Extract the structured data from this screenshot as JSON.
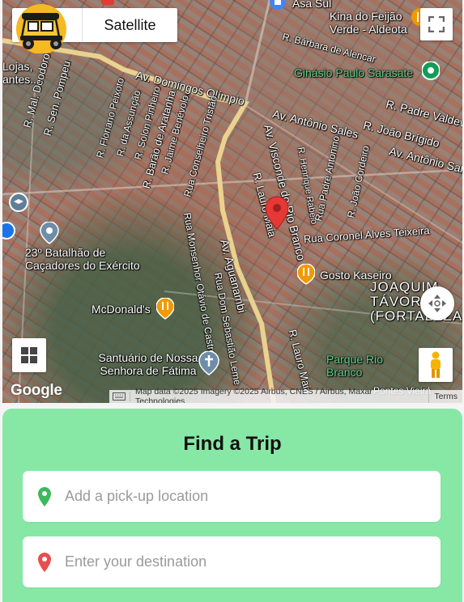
{
  "map": {
    "map_type": {
      "satellite_label": "Satellite"
    },
    "labels": {
      "streets": [
        "Av. Domingos Olímpio",
        "R. Sen. Pompeu",
        "R. Mal. Deodoro",
        "R. Floriano Peixoto",
        "R. da Assunção",
        "R. Solon Pinheiro",
        "R. Barão de Aratanha",
        "R. Jaime Benévolo",
        "Rua Conselheiro Tristão",
        "Av. Antônio Sales",
        "R. João Brígido",
        "Av. Antônio Sal",
        "R. Padre Valdevino",
        "R. Bárbara de Alencar",
        "Av. Visconde do Rio Branco",
        "R. Lauro Maia",
        "R. Henrique Rabelo",
        "Rua Padre Antonino",
        "R. João Cordeiro",
        "Rua Coronel Alves Teixeira",
        "Av. Aguanambi",
        "Rua Monsenhor Otávio de Castro",
        "Rua Dom Sebastião Leme",
        "R. Lauro Maia"
      ],
      "places": [
        "Asa Sul",
        "Kina do Feijão Verde - Aldeota",
        "Ginásio Paulo Sarasate",
        "23º Batalhão de Caçadores do Exército",
        "Gosto Kaseiro",
        "McDonald's",
        "Santuário de Nossa Senhora de Fátima",
        "JOAQUIM TÁVORA (FORTALEZA)",
        "Parque Rio Branco",
        "Lojas, antes...",
        "Pontes Vieira"
      ]
    },
    "google_logo": "Google",
    "attribution": "Map data ©2025 Imagery ©2025 Airbus, CNES / Airbus, Maxar Technologies",
    "terms": "Terms"
  },
  "trip": {
    "title": "Find a Trip",
    "pickup_placeholder": "Add a pick-up location",
    "destination_placeholder": "Enter your destination"
  },
  "colors": {
    "card_bg": "#87e8a5",
    "pickup_pin": "#3db85a",
    "destination_pin": "#ea4d4d",
    "map_marker": "#e53935"
  }
}
